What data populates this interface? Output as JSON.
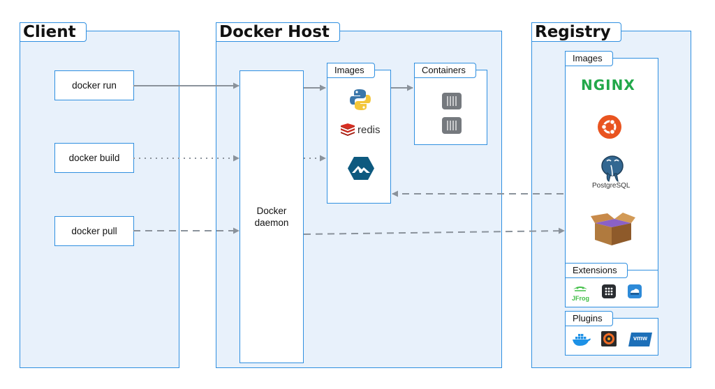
{
  "client": {
    "title": "Client",
    "commands": [
      {
        "label": "docker run"
      },
      {
        "label": "docker build"
      },
      {
        "label": "docker pull"
      }
    ]
  },
  "host": {
    "title": "Docker Host",
    "daemon_line1": "Docker",
    "daemon_line2": "daemon",
    "images_title": "Images",
    "containers_title": "Containers",
    "redis_text": "redis"
  },
  "registry": {
    "title": "Registry",
    "images_title": "Images",
    "nginx_text": "NGINX",
    "postgres_text": "PostgreSQL",
    "extensions_title": "Extensions",
    "jfrog_text": "JFrog",
    "plugins_title": "Plugins",
    "vmw_text": "vmw"
  },
  "icons": {
    "host_images": [
      "python-logo-icon",
      "redis-logo-icon",
      "alpine-logo-icon"
    ],
    "containers": [
      "container-icon",
      "container-icon"
    ],
    "registry_images": [
      "nginx-logo-icon",
      "ubuntu-logo-icon",
      "postgresql-logo-icon",
      "cardboard-box-icon"
    ],
    "extensions": [
      "jfrog-logo-icon",
      "grid-app-icon",
      "cloud-drive-icon"
    ],
    "plugins": [
      "docker-whale-icon",
      "grafana-logo-icon",
      "vmware-logo-icon"
    ]
  },
  "colors": {
    "panel_border": "#2f8fe0",
    "panel_fill": "#e8f1fb",
    "arrow": "#8a929b",
    "nginx_green": "#22a84a",
    "ubuntu_orange": "#e95420",
    "redis_red": "#d82c20",
    "alpine_blue": "#0d597f"
  }
}
